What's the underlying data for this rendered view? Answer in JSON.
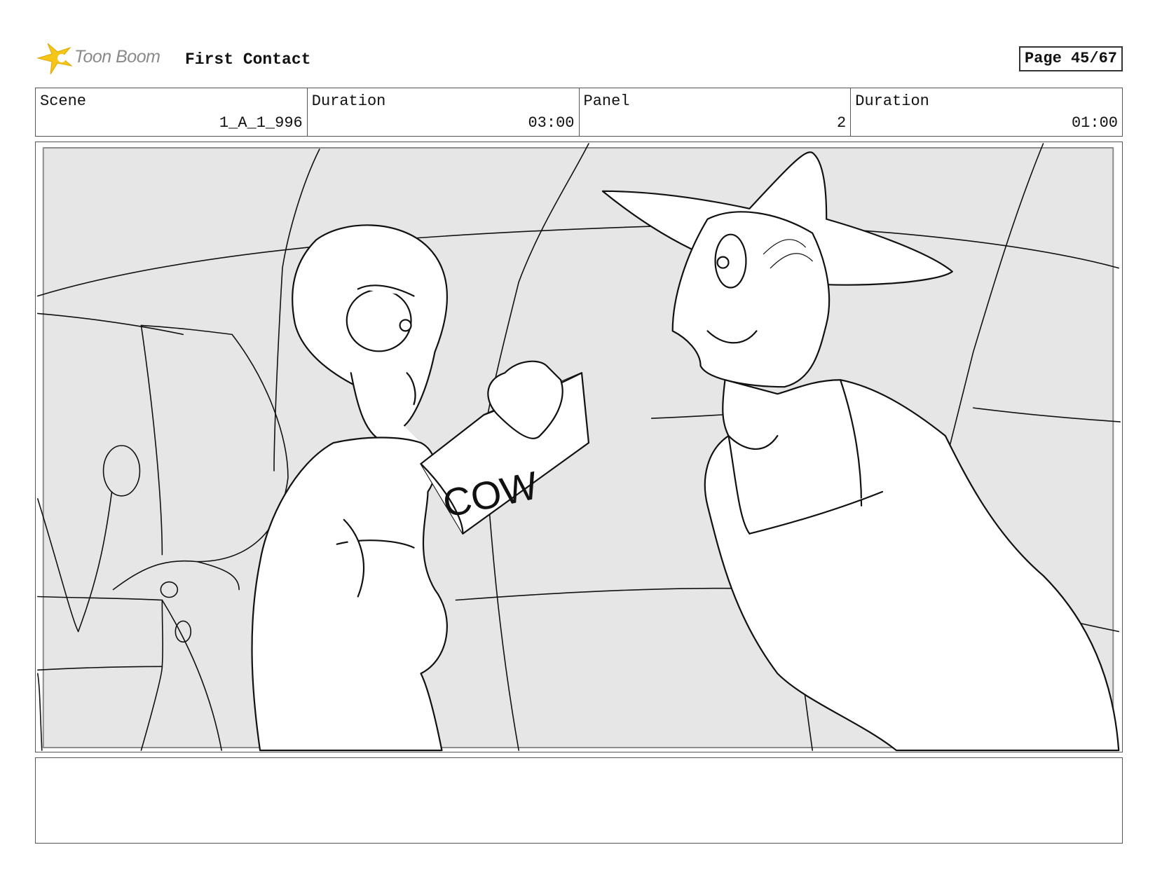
{
  "header": {
    "logo_text": "Toon Boom",
    "project_title": "First Contact",
    "page_label": "Page 45/67"
  },
  "info": [
    {
      "label": "Scene",
      "value": "1_A_1_996"
    },
    {
      "label": "Duration",
      "value": "03:00"
    },
    {
      "label": "Panel",
      "value": "2"
    },
    {
      "label": "Duration",
      "value": "01:00"
    }
  ],
  "panel": {
    "box_label": "COW"
  },
  "notes": {
    "text": ""
  },
  "colors": {
    "logo_star": "#f5c518",
    "panel_background": "#e6e6e6",
    "sketch_line": "#111111"
  }
}
